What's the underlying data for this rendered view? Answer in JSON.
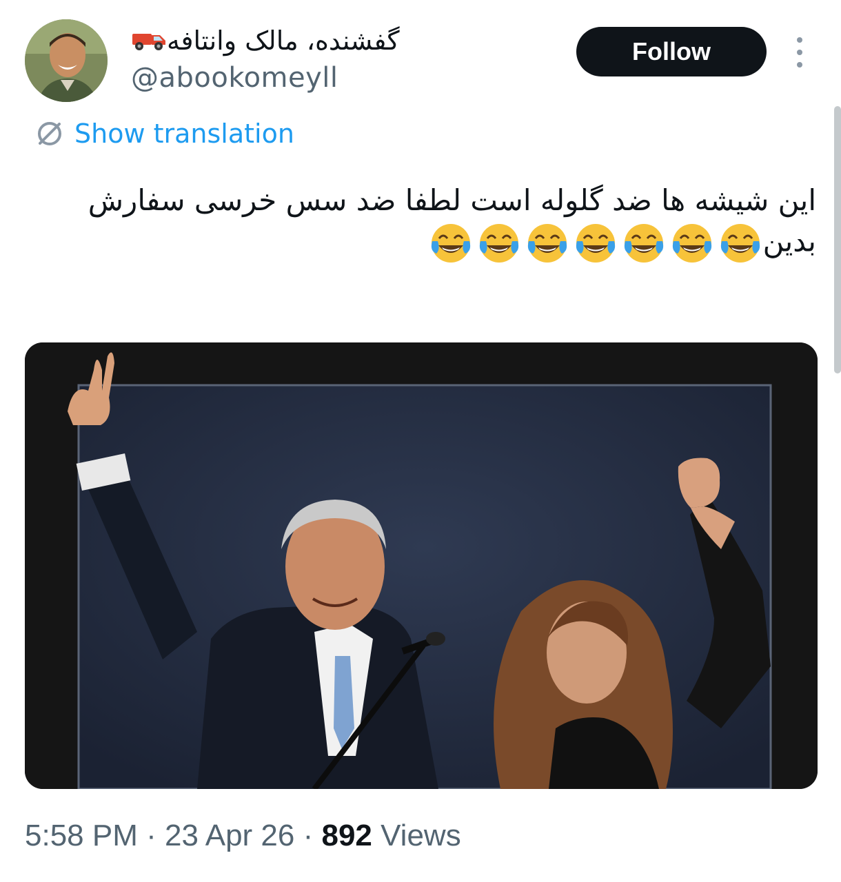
{
  "author": {
    "display_name": "گفشنده، مالک وانتافه",
    "name_emoji": "pickup-truck-icon",
    "handle": "@abookomeyll",
    "avatar": "smiling-man-avatar"
  },
  "header": {
    "follow_label": "Follow",
    "more_icon": "more-vertical-icon"
  },
  "translation": {
    "label": "Show translation",
    "icon": "translate-icon"
  },
  "tweet": {
    "text": "این شیشه ها ضد گلوله است لطفا ضد سس خرسی سفارش بدین",
    "emoji": "face-with-tears-of-joy",
    "emoji_count": 7
  },
  "media": {
    "image": "photo-man-and-woman-waving-behind-glass-panel"
  },
  "meta": {
    "time": "5:58 PM",
    "separator": " · ",
    "date": "23 Apr 26",
    "views_count": "892",
    "views_label": " Views"
  },
  "colors": {
    "link": "#1d9bf0",
    "secondary_text": "#536471",
    "button_bg": "#0f1419"
  }
}
